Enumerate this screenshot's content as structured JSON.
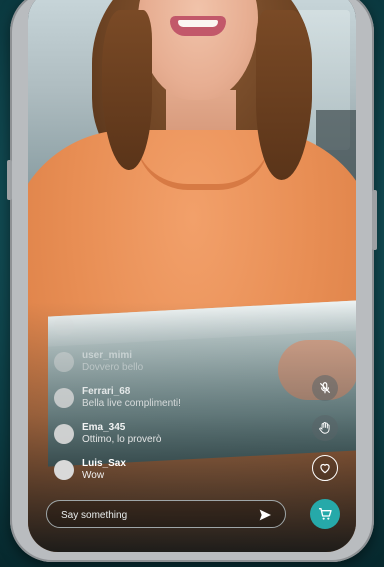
{
  "stream": {
    "comments": [
      {
        "user": "",
        "message": ""
      },
      {
        "user": "user_mimi",
        "message": "Dovvero bello"
      },
      {
        "user": "Ferrari_68",
        "message": "Bella live complimenti!"
      },
      {
        "user": "Ema_345",
        "message": "Ottimo, lo proverò"
      },
      {
        "user": "Luis_Sax",
        "message": "Wow"
      }
    ]
  },
  "actions": {
    "mute_icon": "mic-off-icon",
    "hand_icon": "hand-icon",
    "like_icon": "heart-icon"
  },
  "chat": {
    "placeholder": "Say something",
    "send_icon": "send-icon"
  },
  "cart": {
    "icon": "cart-icon",
    "color": "#26a9a9"
  }
}
